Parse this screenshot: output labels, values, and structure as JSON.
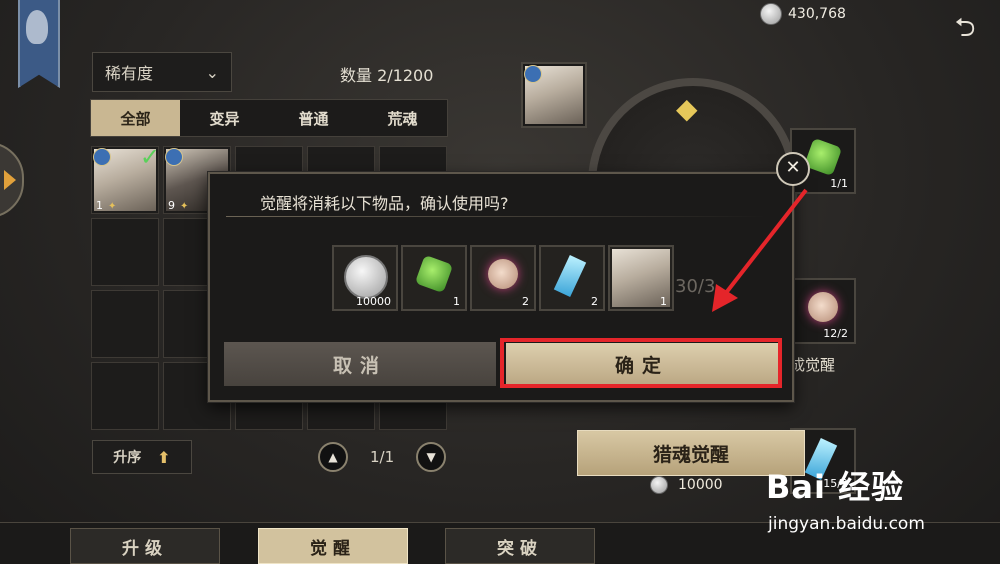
{
  "top": {
    "currency": "430,768",
    "back_icon": "back-arrow-icon"
  },
  "filter": {
    "sort_label": "稀有度",
    "quantity": "数量 2/1200"
  },
  "tabs": [
    "全部",
    "变异",
    "普通",
    "荒魂"
  ],
  "inventory": [
    {
      "level": "1",
      "selected": true
    },
    {
      "level": "9",
      "selected": false
    }
  ],
  "order_label": "升序",
  "pager": {
    "text": "1/1"
  },
  "materials": [
    {
      "count": "1/1",
      "kind": "green-gem"
    },
    {
      "count": "12/2",
      "kind": "pink-stone"
    },
    {
      "count": "15/2",
      "kind": "blue-crystal"
    }
  ],
  "awaken_hint": "成觉醒",
  "hunt_button": "猎魂觉醒",
  "hunt_cost": "10000",
  "dialog": {
    "message": "觉醒将消耗以下物品，确认使用吗?",
    "items": [
      {
        "kind": "silver-coin",
        "count": "10000"
      },
      {
        "kind": "green-gem",
        "count": "1"
      },
      {
        "kind": "pink-stone",
        "count": "2"
      },
      {
        "kind": "blue-crystal",
        "count": "2"
      },
      {
        "kind": "portrait",
        "count": "1"
      }
    ],
    "cancel": "取消",
    "confirm": "确定",
    "behind_text": "30/3"
  },
  "bottom_tabs": [
    "升级",
    "觉醒",
    "突破"
  ],
  "watermark": {
    "logo": "Bai 经验",
    "url": "jingyan.baidu.com"
  },
  "colors": {
    "highlight": "#e5252a",
    "accent_gold": "#c9b792"
  }
}
